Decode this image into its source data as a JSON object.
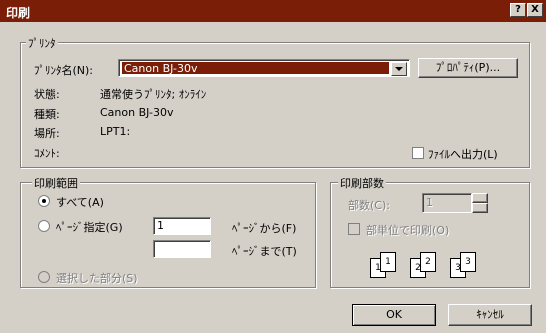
{
  "window": {
    "title": "印刷",
    "help_button": "?",
    "close_button": "X"
  },
  "printer": {
    "group_label": "ﾌﾟﾘﾝﾀ",
    "name_label": "ﾌﾟﾘﾝﾀ名(N):",
    "name_value": "Canon BJ-30v",
    "properties_button": "ﾌﾟﾛﾊﾟﾃｨ(P)...",
    "status_label": "状態:",
    "status_value": "通常使うﾌﾟﾘﾝﾀ; ｵﾝﾗｲﾝ",
    "type_label": "種類:",
    "type_value": "Canon BJ-30v",
    "location_label": "場所:",
    "location_value": "LPT1:",
    "comment_label": "ｺﾒﾝﾄ:",
    "print_to_file_label": "ﾌｧｲﾙへ出力(L)"
  },
  "range": {
    "group_label": "印刷範囲",
    "all_label": "すべて(A)",
    "pages_label": "ﾍﾟｰｼﾞ指定(G)",
    "from_value": "1",
    "from_label": "ﾍﾟｰｼﾞから(F)",
    "to_value": "",
    "to_label": "ﾍﾟｰｼﾞまで(T)",
    "selection_label": "選択した部分(S)"
  },
  "copies": {
    "group_label": "印刷部数",
    "count_label": "部数(C):",
    "count_value": "1",
    "collate_label": "部単位で印刷(O)",
    "collate_icon": "collate-pages-icon",
    "page_numbers": [
      "1",
      "1",
      "2",
      "2",
      "3",
      "3"
    ]
  },
  "buttons": {
    "ok": "OK",
    "cancel": "ｷｬﾝｾﾙ"
  }
}
